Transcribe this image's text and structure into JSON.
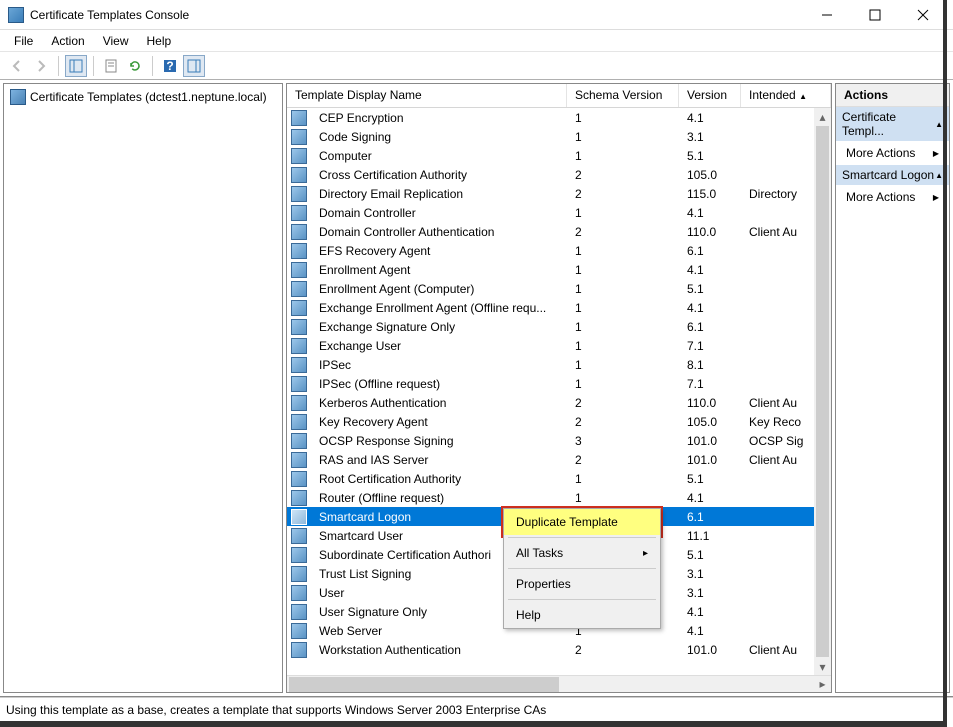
{
  "window": {
    "title": "Certificate Templates Console"
  },
  "menu": {
    "items": [
      "File",
      "Action",
      "View",
      "Help"
    ]
  },
  "tree": {
    "node_label": "Certificate Templates (dctest1.neptune.local)"
  },
  "list": {
    "headers": {
      "name": "Template Display Name",
      "schema": "Schema Version",
      "version": "Version",
      "intended": "Intended"
    },
    "rows": [
      {
        "name": "CEP Encryption",
        "schema": "1",
        "version": "4.1",
        "intended": ""
      },
      {
        "name": "Code Signing",
        "schema": "1",
        "version": "3.1",
        "intended": ""
      },
      {
        "name": "Computer",
        "schema": "1",
        "version": "5.1",
        "intended": ""
      },
      {
        "name": "Cross Certification Authority",
        "schema": "2",
        "version": "105.0",
        "intended": ""
      },
      {
        "name": "Directory Email Replication",
        "schema": "2",
        "version": "115.0",
        "intended": "Directory"
      },
      {
        "name": "Domain Controller",
        "schema": "1",
        "version": "4.1",
        "intended": ""
      },
      {
        "name": "Domain Controller Authentication",
        "schema": "2",
        "version": "110.0",
        "intended": "Client Au"
      },
      {
        "name": "EFS Recovery Agent",
        "schema": "1",
        "version": "6.1",
        "intended": ""
      },
      {
        "name": "Enrollment Agent",
        "schema": "1",
        "version": "4.1",
        "intended": ""
      },
      {
        "name": "Enrollment Agent (Computer)",
        "schema": "1",
        "version": "5.1",
        "intended": ""
      },
      {
        "name": "Exchange Enrollment Agent (Offline requ...",
        "schema": "1",
        "version": "4.1",
        "intended": ""
      },
      {
        "name": "Exchange Signature Only",
        "schema": "1",
        "version": "6.1",
        "intended": ""
      },
      {
        "name": "Exchange User",
        "schema": "1",
        "version": "7.1",
        "intended": ""
      },
      {
        "name": "IPSec",
        "schema": "1",
        "version": "8.1",
        "intended": ""
      },
      {
        "name": "IPSec (Offline request)",
        "schema": "1",
        "version": "7.1",
        "intended": ""
      },
      {
        "name": "Kerberos Authentication",
        "schema": "2",
        "version": "110.0",
        "intended": "Client Au"
      },
      {
        "name": "Key Recovery Agent",
        "schema": "2",
        "version": "105.0",
        "intended": "Key Reco"
      },
      {
        "name": "OCSP Response Signing",
        "schema": "3",
        "version": "101.0",
        "intended": "OCSP Sig"
      },
      {
        "name": "RAS and IAS Server",
        "schema": "2",
        "version": "101.0",
        "intended": "Client Au"
      },
      {
        "name": "Root Certification Authority",
        "schema": "1",
        "version": "5.1",
        "intended": ""
      },
      {
        "name": "Router (Offline request)",
        "schema": "1",
        "version": "4.1",
        "intended": ""
      },
      {
        "name": "Smartcard Logon",
        "schema": "",
        "version": "6.1",
        "intended": "",
        "selected": true
      },
      {
        "name": "Smartcard User",
        "schema": "",
        "version": "11.1",
        "intended": ""
      },
      {
        "name": "Subordinate Certification Authori",
        "schema": "",
        "version": "5.1",
        "intended": ""
      },
      {
        "name": "Trust List Signing",
        "schema": "",
        "version": "3.1",
        "intended": ""
      },
      {
        "name": "User",
        "schema": "",
        "version": "3.1",
        "intended": ""
      },
      {
        "name": "User Signature Only",
        "schema": "",
        "version": "4.1",
        "intended": ""
      },
      {
        "name": "Web Server",
        "schema": "1",
        "version": "4.1",
        "intended": ""
      },
      {
        "name": "Workstation Authentication",
        "schema": "2",
        "version": "101.0",
        "intended": "Client Au"
      }
    ]
  },
  "context_menu": {
    "duplicate": "Duplicate Template",
    "all_tasks": "All Tasks",
    "properties": "Properties",
    "help": "Help"
  },
  "actions": {
    "header": "Actions",
    "section1": "Certificate Templ...",
    "more1": "More Actions",
    "section2": "Smartcard Logon",
    "more2": "More Actions"
  },
  "status": {
    "text": "Using this template as a base, creates a template that supports Windows Server 2003 Enterprise CAs"
  }
}
